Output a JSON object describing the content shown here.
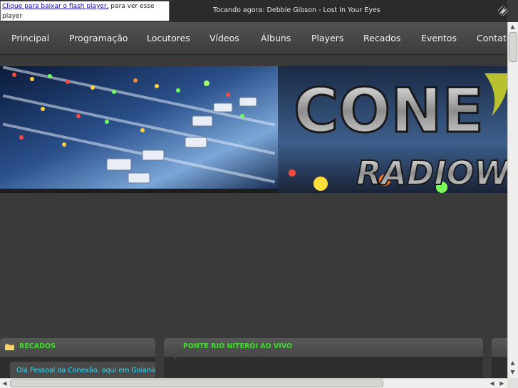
{
  "flash": {
    "link": "Clique para baixar o flash player,",
    "rest": " para ver esse player"
  },
  "now_playing": "Tocando agora: Debbie Gibson - Lost In Your Eyes",
  "nav": [
    "Principal",
    "Programação",
    "Locutores",
    "Vídeos",
    "Álbuns",
    "Players",
    "Recados",
    "Eventos",
    "Contato"
  ],
  "panels": {
    "recados_title": "RECADOS",
    "ponte_title": "PONTE RIO NITERÓI AO VIVO",
    "recado_text": "Olá Pessoal da Conexão, aqui em Goiania"
  },
  "banner": {
    "logo_top": "CONE",
    "logo_bottom": "RADIOW"
  },
  "colors": {
    "accent_green": "#3cdc28",
    "recado_text": "#29e0ff"
  },
  "icons": [
    "site-logo-icon",
    "folder-icon"
  ]
}
